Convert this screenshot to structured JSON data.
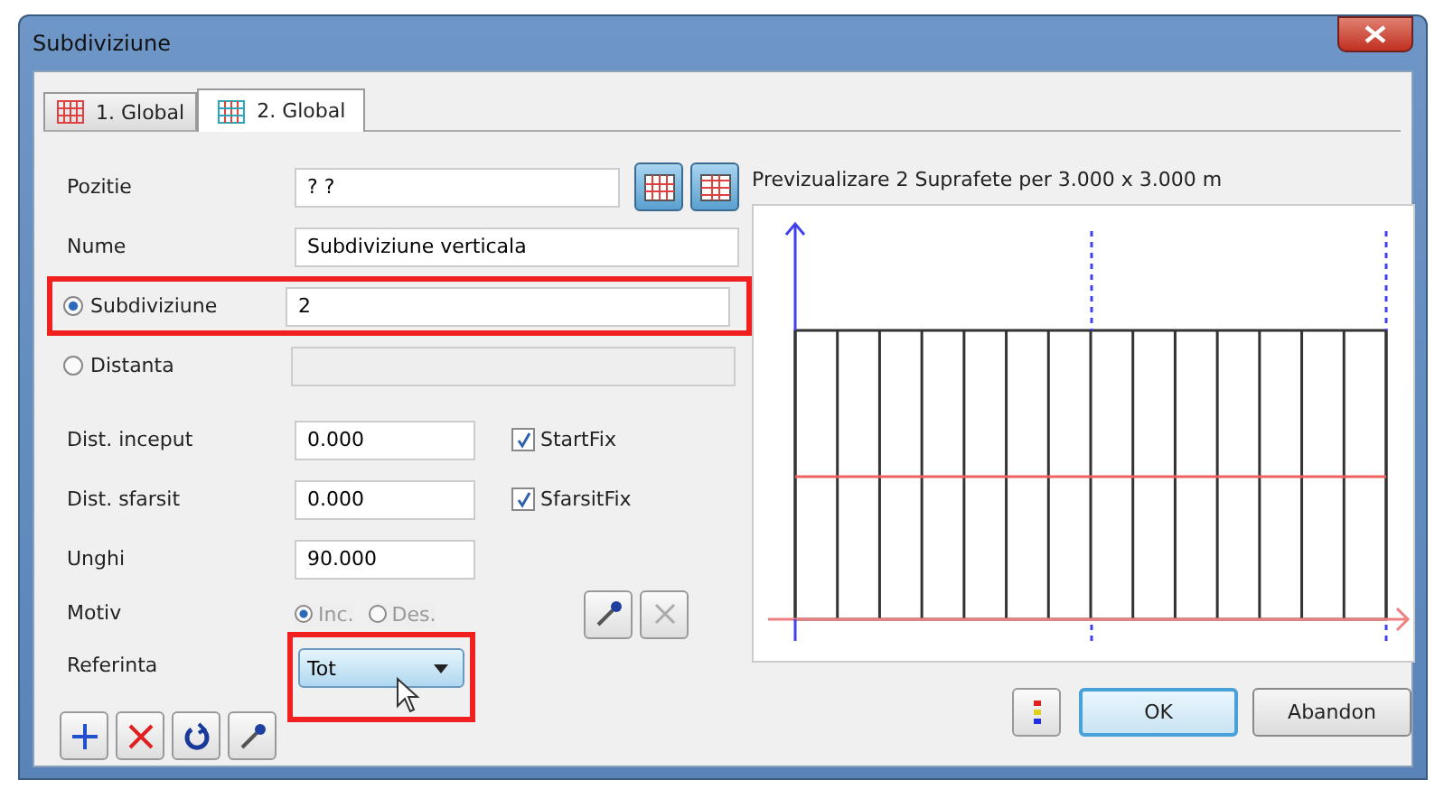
{
  "window": {
    "title": "Subdiviziune"
  },
  "tabs": [
    {
      "label": "1. Global",
      "selected": false
    },
    {
      "label": "2. Global",
      "selected": true
    }
  ],
  "fields": [
    {
      "kind": "text",
      "label": "Pozitie",
      "value": "? ?"
    },
    {
      "kind": "text",
      "label": "Nume",
      "value": "Subdiviziune verticala"
    },
    {
      "kind": "radio",
      "label": "Subdiviziune",
      "value": "2",
      "selected": true,
      "highlighted": true
    },
    {
      "kind": "radio",
      "label": "Distanta",
      "selected": false,
      "highlighted": false
    }
  ],
  "distances": [
    {
      "label": "Dist. inceput",
      "value": "0.000",
      "check": {
        "label": "StartFix",
        "checked": true
      }
    },
    {
      "label": "Dist. sfarsit",
      "value": "0.000",
      "check": {
        "label": "SfarsitFix",
        "checked": true
      }
    },
    {
      "label": "Unghi",
      "value": "90.000"
    }
  ],
  "motiv": {
    "label": "Motiv",
    "disabled": true,
    "options": [
      {
        "label": "Inc.",
        "selected": true
      },
      {
        "label": "Des.",
        "selected": false
      }
    ]
  },
  "referinta": {
    "label": "Referinta",
    "value": "Tot",
    "highlighted": true
  },
  "preview": {
    "caption": "Previzualizare 2 Suprafete per 3.000 x 3.000 m"
  },
  "buttons": [
    {
      "label": "OK",
      "default": true
    },
    {
      "label": "Abandon",
      "default": false
    }
  ]
}
